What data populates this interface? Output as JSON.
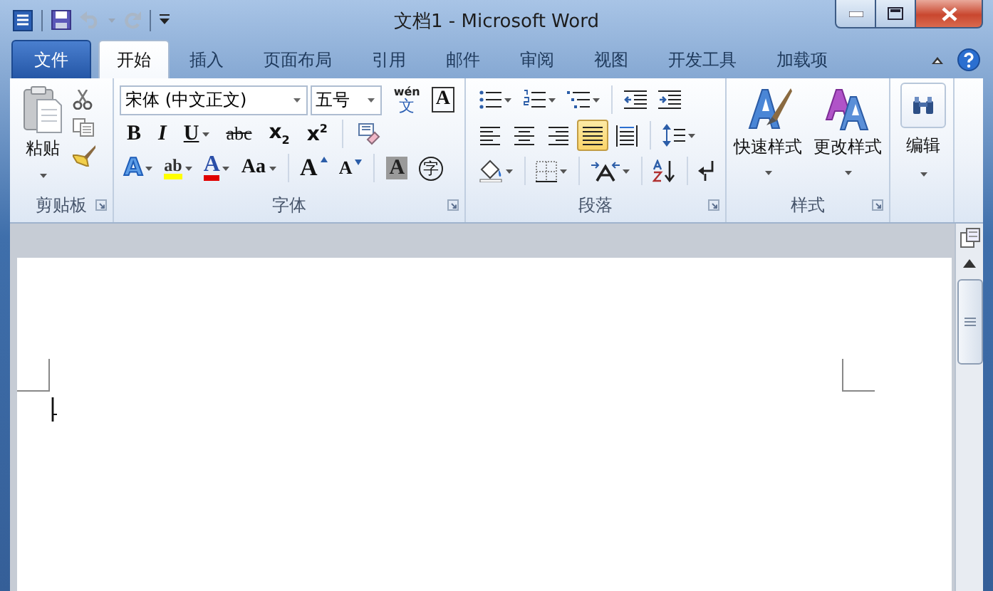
{
  "window": {
    "title": "文档1 - Microsoft Word"
  },
  "quick_access": [
    {
      "kind": "save",
      "disabled": false
    },
    {
      "kind": "undo",
      "disabled": true
    },
    {
      "kind": "redo",
      "disabled": true
    }
  ],
  "tabs": [
    {
      "label": "文件",
      "kind": "file",
      "selected": false
    },
    {
      "label": "开始",
      "kind": "tab",
      "selected": true
    },
    {
      "label": "插入",
      "kind": "tab",
      "selected": false
    },
    {
      "label": "页面布局",
      "kind": "tab",
      "selected": false
    },
    {
      "label": "引用",
      "kind": "tab",
      "selected": false
    },
    {
      "label": "邮件",
      "kind": "tab",
      "selected": false
    },
    {
      "label": "审阅",
      "kind": "tab",
      "selected": false
    },
    {
      "label": "视图",
      "kind": "tab",
      "selected": false
    },
    {
      "label": "开发工具",
      "kind": "tab",
      "selected": false
    },
    {
      "label": "加载项",
      "kind": "tab",
      "selected": false
    }
  ],
  "ribbon": {
    "clipboard": {
      "label": "剪贴板",
      "paste": "粘贴"
    },
    "font": {
      "label": "字体",
      "font_name": "宋体 (中文正文)",
      "font_size": "五号",
      "top_buttons": [
        {
          "kind": "phonetic",
          "glyph": "文",
          "ruby": "wén",
          "dropdown": false
        },
        {
          "kind": "border",
          "glyph": "A",
          "dropdown": false
        }
      ],
      "format_buttons": [
        {
          "kind": "bold",
          "glyph": "B",
          "dropdown": false
        },
        {
          "kind": "italic",
          "glyph": "I",
          "dropdown": false
        },
        {
          "kind": "underline",
          "glyph": "U",
          "dropdown": true
        },
        {
          "kind": "strike",
          "glyph": "abc",
          "dropdown": false
        },
        {
          "kind": "sub",
          "glyph": "x$_{2}$",
          "dropdown": false
        },
        {
          "kind": "sup",
          "glyph": "x$^{2}$",
          "dropdown": false
        },
        {
          "kind": "sep"
        },
        {
          "kind": "clear",
          "dropdown": false
        }
      ],
      "effect_buttons": [
        {
          "kind": "effect",
          "glyph": "A",
          "dropdown": true
        },
        {
          "kind": "highlight",
          "glyph": "ab",
          "dropdown": true
        },
        {
          "kind": "color",
          "glyph": "A",
          "dropdown": true
        },
        {
          "kind": "case",
          "glyph": "Aa",
          "dropdown": true
        },
        {
          "kind": "sep"
        },
        {
          "kind": "grow",
          "glyph": "A",
          "dropdown": false
        },
        {
          "kind": "shrink",
          "glyph": "A",
          "dropdown": false
        },
        {
          "kind": "sep"
        },
        {
          "kind": "shade",
          "glyph": "A",
          "dropdown": false
        },
        {
          "kind": "enclose",
          "glyph": "字",
          "dropdown": false
        }
      ]
    },
    "paragraph": {
      "label": "段落",
      "alignment": [
        {
          "kind": "left",
          "selected": false
        },
        {
          "kind": "center",
          "selected": false
        },
        {
          "kind": "right",
          "selected": false
        },
        {
          "kind": "justify",
          "selected": true
        },
        {
          "kind": "distributed",
          "selected": false
        }
      ]
    },
    "styles": {
      "label": "样式",
      "buttons": [
        {
          "label": "快速样式",
          "kind": "quick"
        },
        {
          "label": "更改样式",
          "kind": "change"
        }
      ]
    },
    "editing": {
      "label": "编辑"
    }
  }
}
